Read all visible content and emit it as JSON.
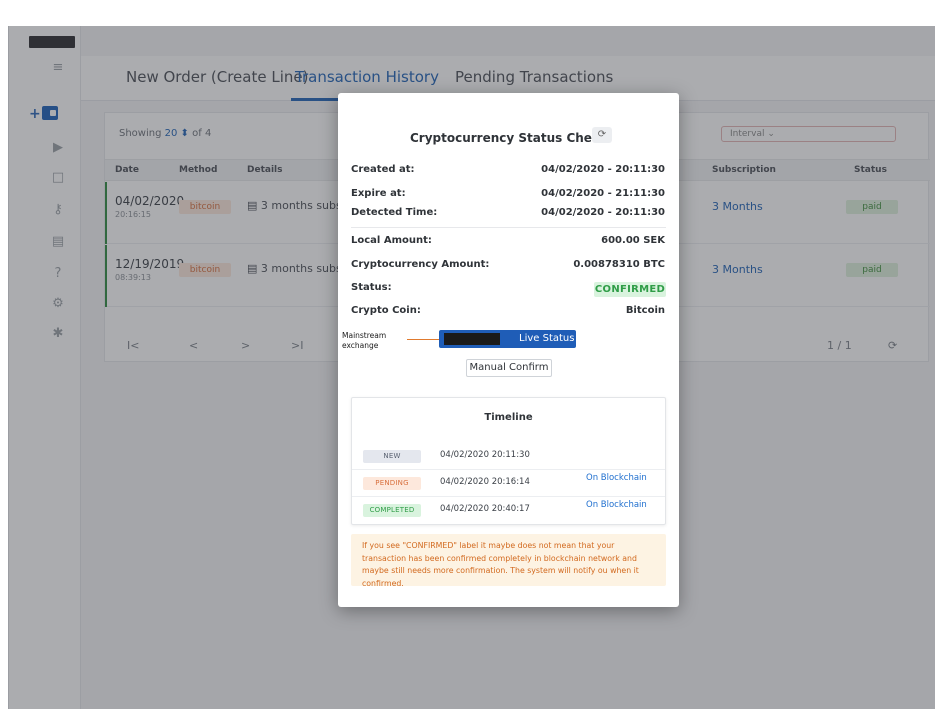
{
  "tabs": [
    {
      "label": "New Order (Create Line)",
      "active": false
    },
    {
      "label": "Transaction History",
      "active": true
    },
    {
      "label": "Pending Transactions",
      "active": false
    }
  ],
  "sidebar": {
    "icons": [
      "list-check-icon",
      "wallet-icon",
      "play-icon",
      "clipboard-icon",
      "key-icon",
      "document-icon",
      "help-icon",
      "gear-icon",
      "puzzle-icon"
    ],
    "plus": "+"
  },
  "list": {
    "showing_label": "Showing",
    "page_size": "20 ⬍",
    "of_label": "of 4",
    "interval_label": "Interval ⌄",
    "columns": [
      "Date",
      "Method",
      "Details",
      "Subscription",
      "Status"
    ],
    "rows": [
      {
        "date": "04/02/2020",
        "time": "20:16:15",
        "method": "bitcoin",
        "details": "▤ 3 months subsc",
        "subscription": "3 Months",
        "status": "paid"
      },
      {
        "date": "12/19/2019",
        "time": "08:39:13",
        "method": "bitcoin",
        "details": "▤ 3 months subsc",
        "subscription": "3 Months",
        "status": "paid"
      }
    ],
    "pager": {
      "first": "I<",
      "prev": "<",
      "next": ">",
      "last": ">I",
      "page_info": "1 / 1",
      "refresh": "⟳"
    }
  },
  "modal": {
    "title": "Cryptocurrency Status Check",
    "refresh_icon": "⟳",
    "fields": [
      {
        "label": "Created at:",
        "value": "04/02/2020 - 20:11:30"
      },
      {
        "label": "Expire at:",
        "value": "04/02/2020 - 21:11:30"
      },
      {
        "label": "Detected Time:",
        "value": "04/02/2020 - 20:11:30"
      },
      {
        "label": "Local Amount:",
        "value": "600.00 SEK"
      },
      {
        "label": "Cryptocurrency Amount:",
        "value": "0.00878310 BTC"
      },
      {
        "label": "Status:",
        "value": "CONFIRMED"
      },
      {
        "label": "Crypto Coin:",
        "value": "Bitcoin"
      }
    ],
    "annotation": "Mainstream exchange",
    "live_status_label": "Live Status",
    "manual_confirm_label": "Manual Confirm",
    "timeline": {
      "title": "Timeline",
      "entries": [
        {
          "badge": "NEW",
          "time": "04/02/2020 20:11:30",
          "link": ""
        },
        {
          "badge": "PENDING",
          "time": "04/02/2020 20:16:14",
          "link": "On Blockchain"
        },
        {
          "badge": "COMPLETED",
          "time": "04/02/2020 20:40:17",
          "link": "On Blockchain"
        }
      ]
    },
    "note": "If you see \"CONFIRMED\" label it maybe does not mean that your transaction has been confirmed completely in blockchain network and maybe still needs more confirmation. The system will notify ou when it confirmed."
  },
  "colors": {
    "accent": "#1f63b7",
    "confirmed_bg": "#d9f3de",
    "confirmed_fg": "#2f9d47",
    "note_fg": "#d2691e"
  }
}
